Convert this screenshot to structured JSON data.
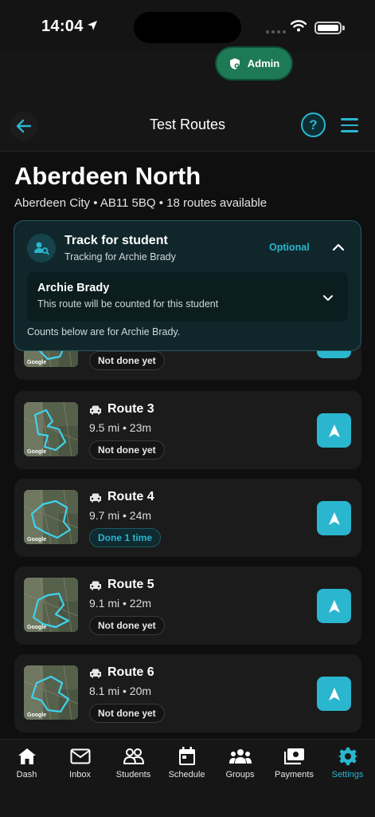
{
  "status_bar": {
    "time": "14:04"
  },
  "header": {
    "admin_label": "Admin",
    "title": "Test Routes",
    "help_label": "?"
  },
  "location": {
    "name": "Aberdeen North",
    "meta": "Aberdeen City • AB11 5BQ • 18 routes available"
  },
  "track": {
    "title": "Track for student",
    "subtitle": "Tracking for Archie Brady",
    "optional_label": "Optional",
    "student_name": "Archie Brady",
    "student_note": "This route will be counted for this student",
    "counts_note": "Counts below are for Archie Brady."
  },
  "routes": [
    {
      "name": "",
      "stats": "",
      "status": "Not done yet",
      "done": false
    },
    {
      "name": "Route 3",
      "stats": "9.5 mi • 23m",
      "status": "Not done yet",
      "done": false
    },
    {
      "name": "Route 4",
      "stats": "9.7 mi • 24m",
      "status": "Done 1 time",
      "done": true
    },
    {
      "name": "Route 5",
      "stats": "9.1 mi • 22m",
      "status": "Not done yet",
      "done": false
    },
    {
      "name": "Route 6",
      "stats": "8.1 mi • 20m",
      "status": "Not done yet",
      "done": false
    }
  ],
  "map_attribution": "Google",
  "tabs": [
    {
      "label": "Dash",
      "icon": "home-icon"
    },
    {
      "label": "Inbox",
      "icon": "mail-icon"
    },
    {
      "label": "Students",
      "icon": "people-icon"
    },
    {
      "label": "Schedule",
      "icon": "calendar-icon"
    },
    {
      "label": "Groups",
      "icon": "group-icon"
    },
    {
      "label": "Payments",
      "icon": "payments-icon"
    },
    {
      "label": "Settings",
      "icon": "gear-icon",
      "active": true
    }
  ],
  "colors": {
    "accent": "#2ab6cf",
    "admin_green": "#1e7a56",
    "background": "#0f0f10"
  }
}
